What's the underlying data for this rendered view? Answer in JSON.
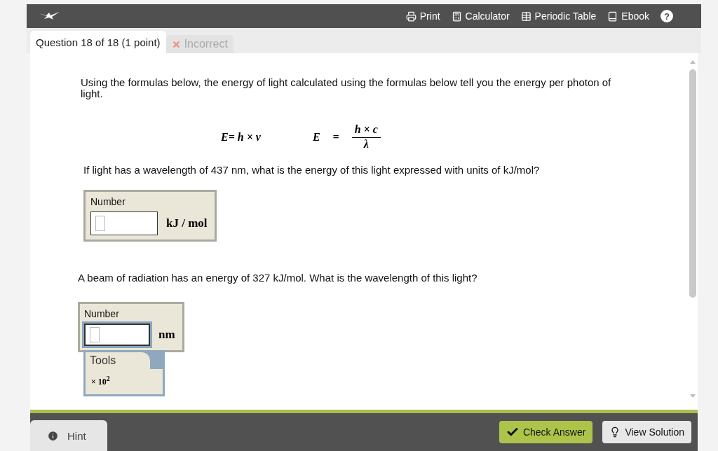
{
  "toolbar": {
    "items": [
      {
        "kind": "print",
        "label": "Print"
      },
      {
        "kind": "calculator",
        "label": "Calculator"
      },
      {
        "kind": "table",
        "label": "Periodic Table"
      },
      {
        "kind": "book",
        "label": "Ebook"
      },
      {
        "kind": "help",
        "label": "?"
      }
    ]
  },
  "tabs": [
    {
      "label": "Question 18 of 18 (1 point)",
      "selected": true,
      "kind": "question"
    },
    {
      "label": "Incorrect",
      "selected": false,
      "kind": "incorrect"
    }
  ],
  "intro": "Using the formulas below, the energy of light calculated using the formulas below tell you the energy per photon of light.",
  "formulas": [
    {
      "kind": "product",
      "text": "E= h × ν"
    },
    {
      "kind": "fraction",
      "lhs": "E",
      "eq": "=",
      "numerator": "h × c",
      "denominator": "λ"
    }
  ],
  "parts": [
    {
      "prompt": "If light has a wavelength of  437 nm, what is the energy of this light expressed with units of kJ/mol?",
      "field_label": "Number",
      "unit": "kJ / mol",
      "focused": false
    },
    {
      "prompt": "A beam of radiation has an energy of 327 kJ/mol. What is the wavelength of this light?",
      "field_label": "Number",
      "unit": "nm",
      "focused": true,
      "tools": {
        "title": "Tools",
        "items": [
          "× 10$^{2}$"
        ]
      }
    }
  ],
  "footer": {
    "hint": "Hint",
    "buttons": [
      {
        "kind": "check",
        "label": "Check Answer"
      },
      {
        "kind": "solution",
        "label": "View Solution"
      }
    ]
  }
}
